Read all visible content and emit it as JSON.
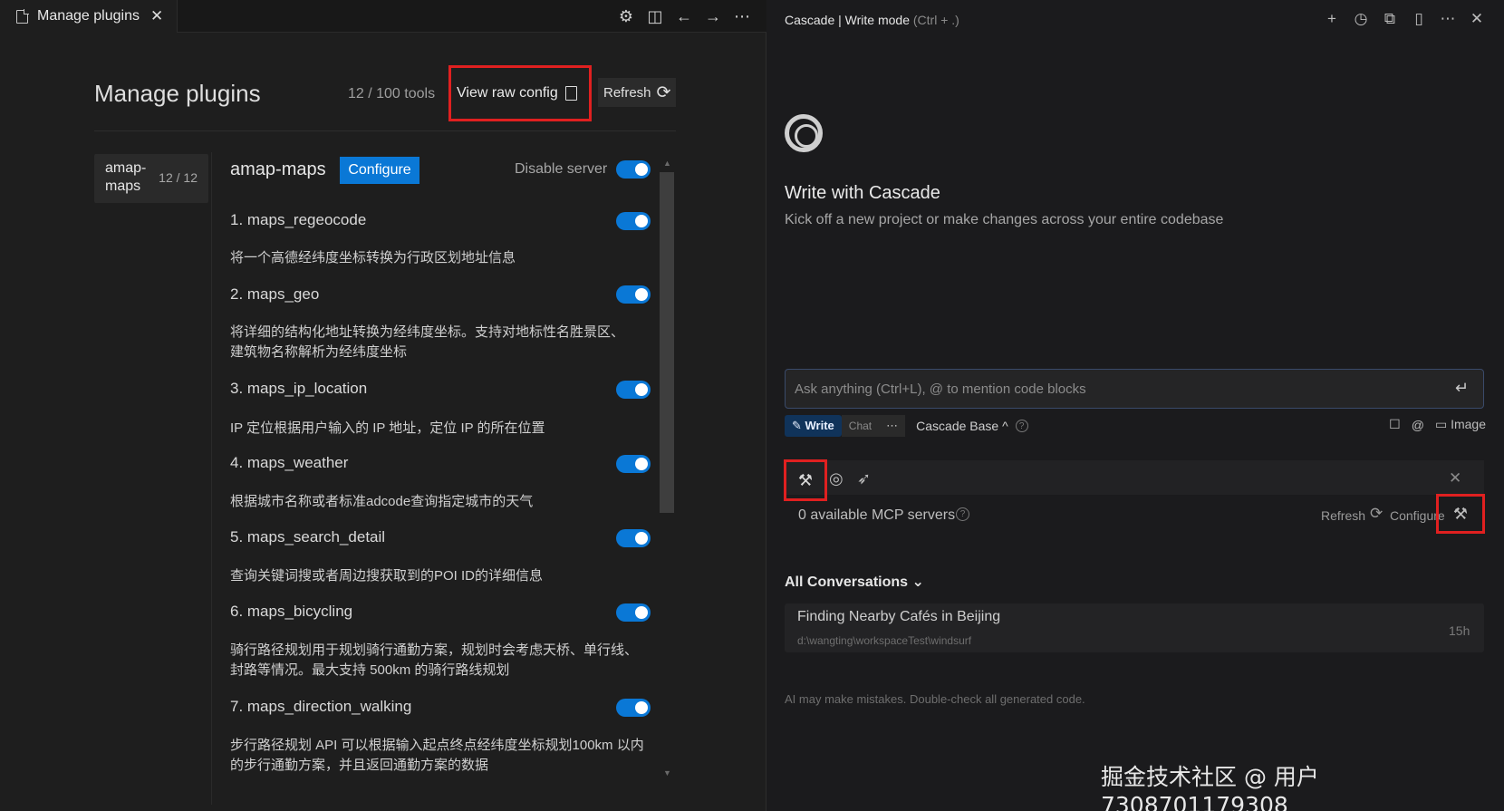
{
  "tab": {
    "title": "Manage plugins",
    "close": "✕"
  },
  "tab_actions": [
    "⚙",
    "◫",
    "←",
    "→",
    "⋯"
  ],
  "plugins": {
    "title": "Manage plugins",
    "tool_count": "12 / 100 tools",
    "view_raw_config": "View raw config",
    "refresh": "Refresh",
    "refresh_icon": "⟳",
    "server": {
      "name": "amap-maps",
      "count": "12 / 12"
    },
    "detail": {
      "title": "amap-maps",
      "configure": "Configure",
      "disable_server": "Disable server"
    },
    "tools": [
      {
        "name": "1. maps_regeocode",
        "desc": "将一个高德经纬度坐标转换为行政区划地址信息"
      },
      {
        "name": "2. maps_geo",
        "desc": "将详细的结构化地址转换为经纬度坐标。支持对地标性名胜景区、建筑物名称解析为经纬度坐标"
      },
      {
        "name": "3. maps_ip_location",
        "desc": "IP 定位根据用户输入的 IP 地址，定位 IP 的所在位置"
      },
      {
        "name": "4. maps_weather",
        "desc": "根据城市名称或者标准adcode查询指定城市的天气"
      },
      {
        "name": "5. maps_search_detail",
        "desc": "查询关键词搜或者周边搜获取到的POI ID的详细信息"
      },
      {
        "name": "6. maps_bicycling",
        "desc": "骑行路径规划用于规划骑行通勤方案，规划时会考虑天桥、单行线、封路等情况。最大支持 500km 的骑行路线规划"
      },
      {
        "name": "7. maps_direction_walking",
        "desc": "步行路径规划 API 可以根据输入起点终点经纬度坐标规划100km 以内的步行通勤方案，并且返回通勤方案的数据"
      }
    ]
  },
  "cascade": {
    "title": "Cascade | Write mode",
    "shortcut": "(Ctrl + .)",
    "actions": [
      "+",
      "◷",
      "⧉",
      "▯",
      "⋯",
      "✕"
    ],
    "heading": "Write with Cascade",
    "subheading": "Kick off a new project or make changes across your entire codebase",
    "input_placeholder": "Ask anything (Ctrl+L), @ to mention code blocks",
    "enter_icon": "↵",
    "mode_write": "Write",
    "mode_chat": "Chat",
    "mode_more": "⋯",
    "model": "Cascade Base ^",
    "help": "?",
    "image_label": "Image",
    "mcp_count": "0 available MCP servers",
    "mcp_refresh": "Refresh",
    "mcp_configure": "Configure",
    "conversations_header": "All Conversations ⌄",
    "conversation": {
      "title": "Finding Nearby Cafés in Beijing",
      "path": "d:\\wangting\\workspaceTest\\windsurf",
      "time": "15h"
    },
    "disclaimer": "AI may make mistakes. Double-check all generated code."
  },
  "watermark": "掘金技术社区 @ 用户7308701179308"
}
